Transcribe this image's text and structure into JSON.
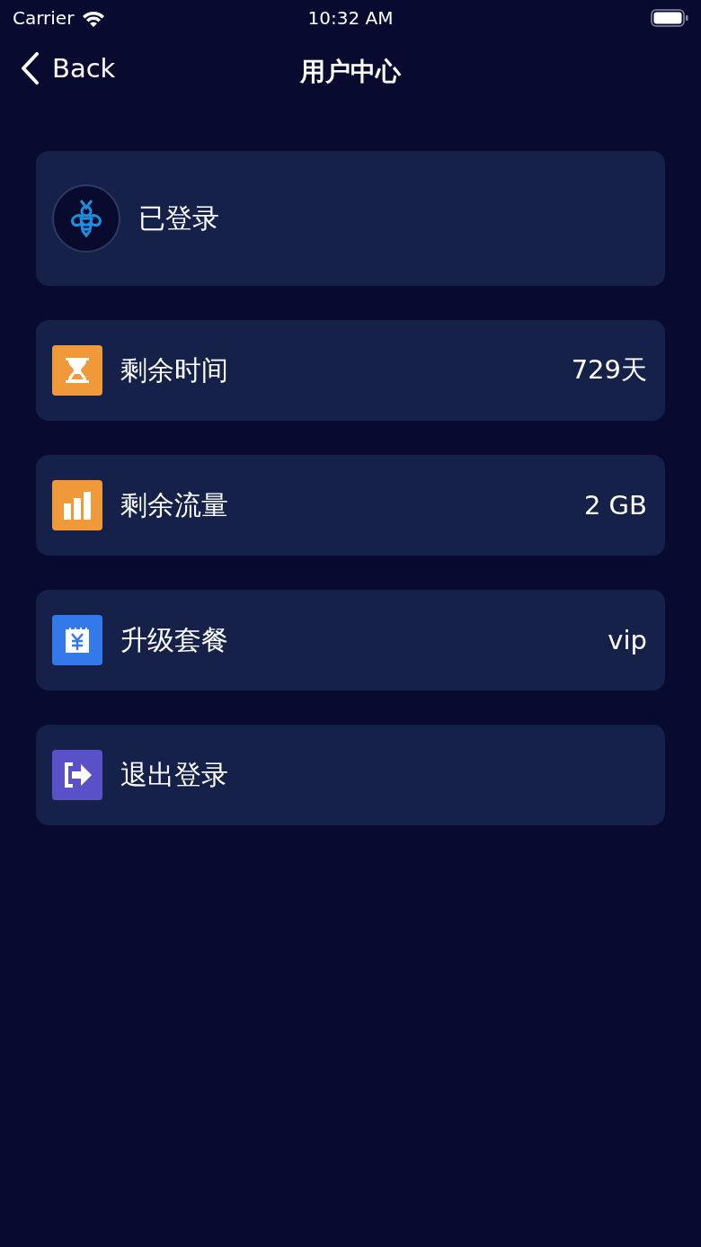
{
  "status_bar": {
    "carrier": "Carrier",
    "time": "10:32 AM"
  },
  "nav": {
    "back": "Back",
    "title": "用户中心"
  },
  "account": {
    "status": "已登录"
  },
  "items": [
    {
      "kind": "time",
      "label": "剩余时间",
      "value": "729天",
      "color": "#f0993a"
    },
    {
      "kind": "traffic",
      "label": "剩余流量",
      "value": "2 GB",
      "color": "#f0993a"
    },
    {
      "kind": "upgrade",
      "label": "升级套餐",
      "value": "vip",
      "color": "#3479ea"
    },
    {
      "kind": "logout",
      "label": "退出登录",
      "color": "#5a50c8"
    }
  ]
}
